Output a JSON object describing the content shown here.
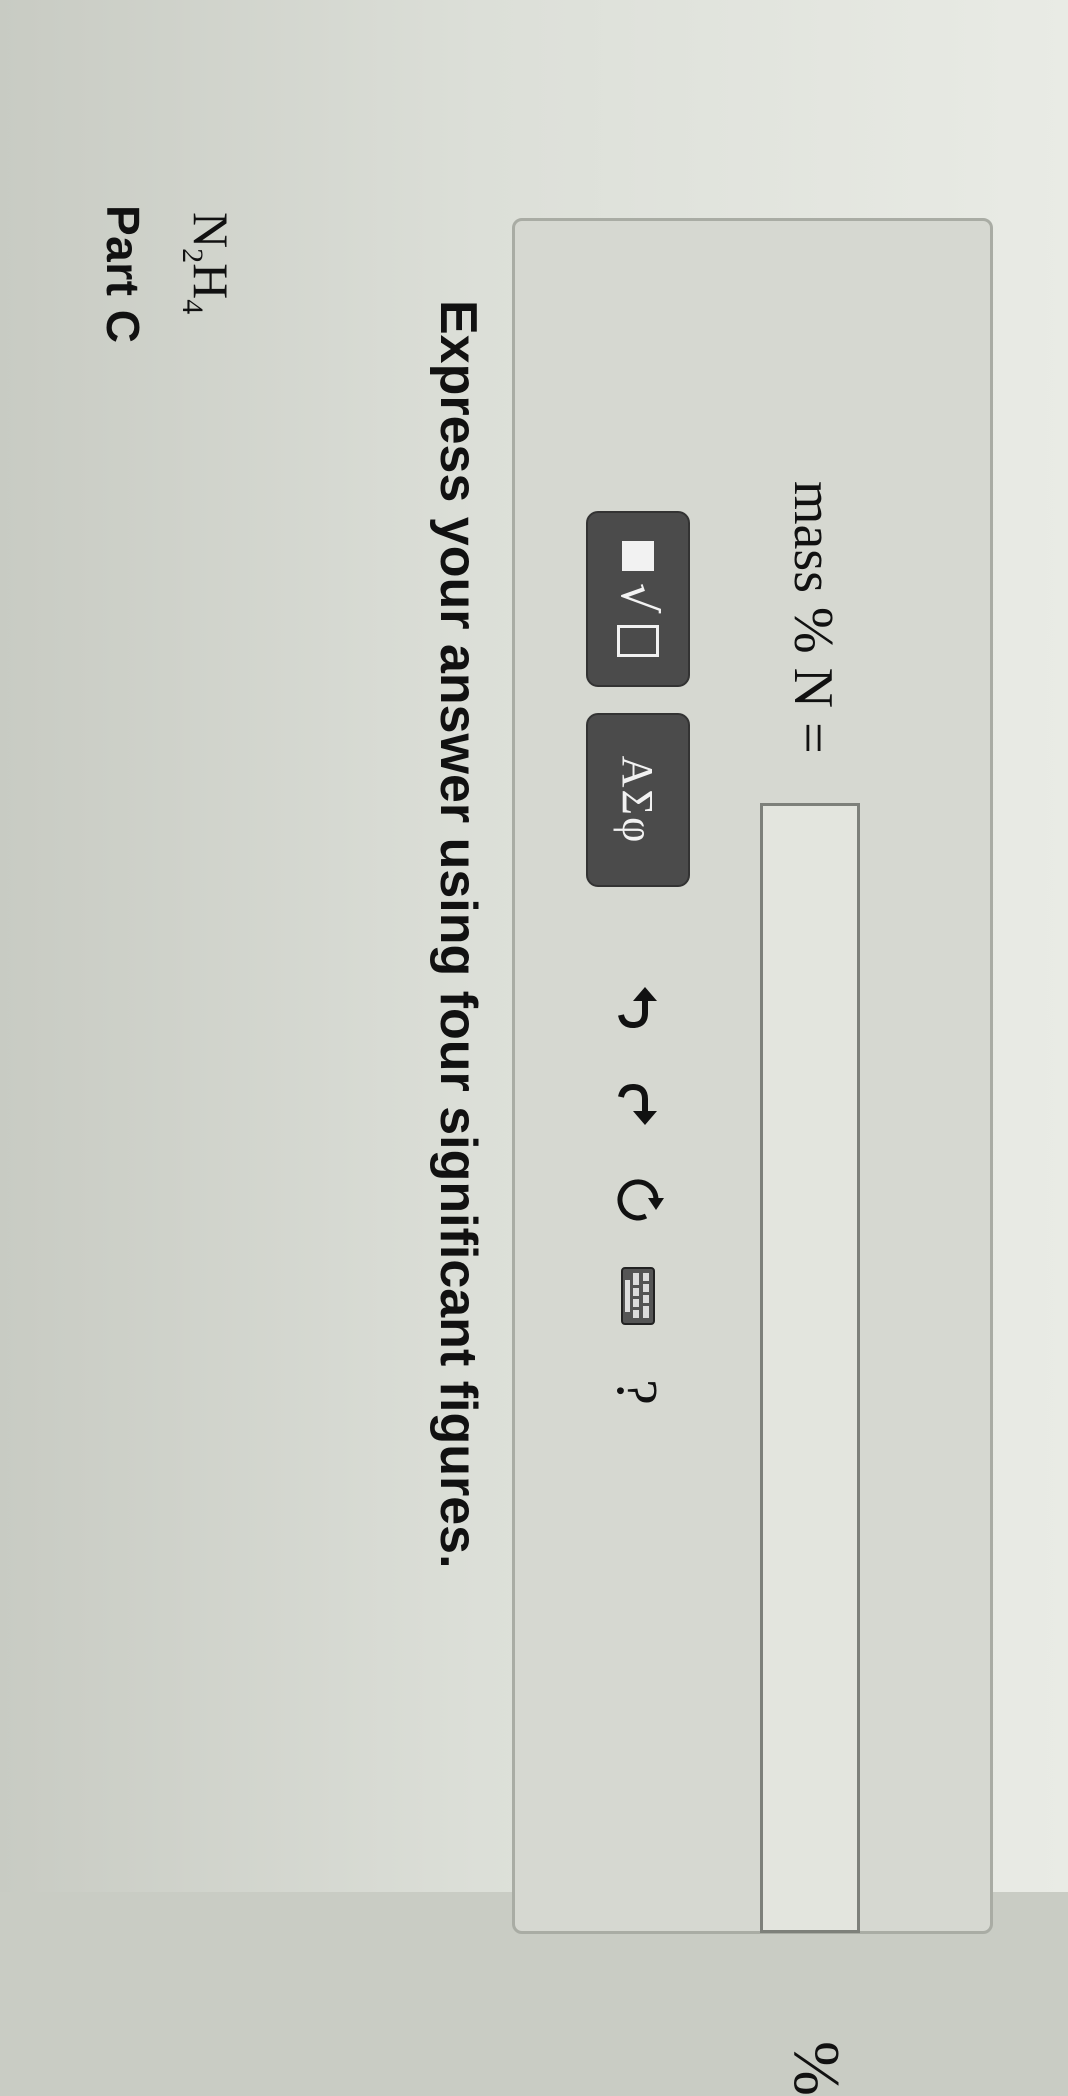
{
  "part": {
    "title": "Part C"
  },
  "compound": {
    "elements": [
      {
        "symbol": "N",
        "subscript": "2"
      },
      {
        "symbol": "H",
        "subscript": "4"
      }
    ]
  },
  "instruction": "Express your answer using four significant figures.",
  "toolbar": {
    "buttons": [
      {
        "icon": "templates-icon",
        "interactable": true
      },
      {
        "icon": "greek-letters-icon",
        "label": "ΑΣφ",
        "interactable": true
      },
      {
        "icon": "undo-icon",
        "interactable": true
      },
      {
        "icon": "redo-icon",
        "interactable": true
      },
      {
        "icon": "reset-icon",
        "interactable": true
      },
      {
        "icon": "keyboard-icon",
        "interactable": true
      },
      {
        "icon": "help-icon",
        "label": "?",
        "interactable": true
      }
    ]
  },
  "answer": {
    "label": "mass % N =",
    "value": "",
    "unit": "%"
  },
  "colors": {
    "toolbar_button_bg": "#4b4b4b",
    "panel_bg": "#d6d8d1"
  }
}
